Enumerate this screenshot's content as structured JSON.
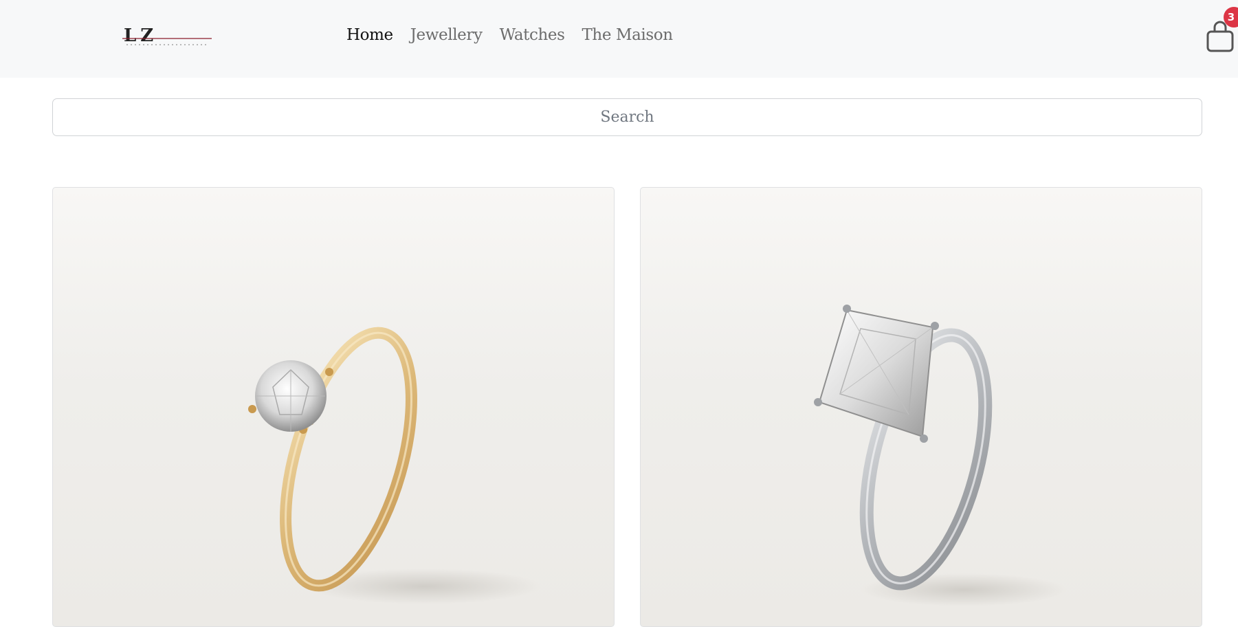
{
  "header": {
    "logo_icon": "lz-jewelry-logo",
    "nav": [
      {
        "label": "Home",
        "active": true
      },
      {
        "label": "Jewellery",
        "active": false
      },
      {
        "label": "Watches",
        "active": false
      },
      {
        "label": "The Maison",
        "active": false
      }
    ],
    "cart": {
      "icon": "shopping-bag-icon",
      "count": "3",
      "badge_color": "#dc3545"
    }
  },
  "search": {
    "placeholder": "Search",
    "value": ""
  },
  "products": [
    {
      "image": "gold-solitaire-diamond-ring",
      "metal_color": "#e3bf82"
    },
    {
      "image": "platinum-cushion-diamond-ring",
      "metal_color": "#b9bcc0"
    }
  ]
}
